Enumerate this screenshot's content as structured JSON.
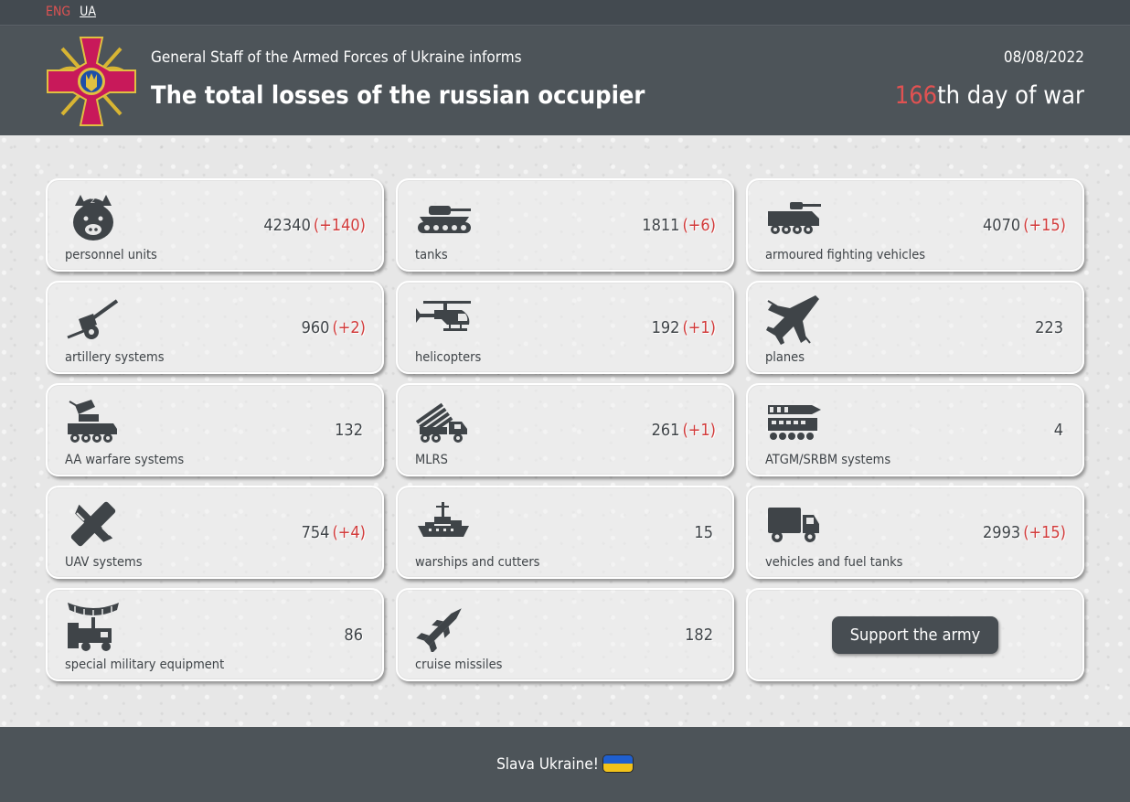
{
  "lang": {
    "eng": "ENG",
    "ua": "UA"
  },
  "header": {
    "subtitle": "General Staff of the Armed Forces of Ukraine informs",
    "title": "The total losses of the russian occupier",
    "date": "08/08/2022",
    "day_number": "166",
    "day_suffix": "th day of war"
  },
  "colors": {
    "accent_red": "#d23c3c",
    "dark": "#4d5459",
    "icon": "#3f4448"
  },
  "cards": [
    {
      "icon": "pig-icon",
      "label": "personnel units",
      "value": "42340",
      "delta": "(+140)"
    },
    {
      "icon": "tank-icon",
      "label": "tanks",
      "value": "1811",
      "delta": "(+6)"
    },
    {
      "icon": "afv-icon",
      "label": "armoured fighting vehicles",
      "value": "4070",
      "delta": "(+15)"
    },
    {
      "icon": "artillery-icon",
      "label": "artillery systems",
      "value": "960",
      "delta": "(+2)"
    },
    {
      "icon": "helicopter-icon",
      "label": "helicopters",
      "value": "192",
      "delta": "(+1)"
    },
    {
      "icon": "plane-icon",
      "label": "planes",
      "value": "223",
      "delta": ""
    },
    {
      "icon": "aa-warfare-icon",
      "label": "AA warfare systems",
      "value": "132",
      "delta": ""
    },
    {
      "icon": "mlrs-icon",
      "label": "MLRS",
      "value": "261",
      "delta": "(+1)"
    },
    {
      "icon": "atgm-icon",
      "label": "ATGM/SRBM systems",
      "value": "4",
      "delta": ""
    },
    {
      "icon": "uav-icon",
      "label": "UAV systems",
      "value": "754",
      "delta": "(+4)"
    },
    {
      "icon": "warship-icon",
      "label": "warships and cutters",
      "value": "15",
      "delta": ""
    },
    {
      "icon": "truck-icon",
      "label": "vehicles and fuel tanks",
      "value": "2993",
      "delta": "(+15)"
    },
    {
      "icon": "special-equipment-icon",
      "label": "special military equipment",
      "value": "86",
      "delta": ""
    },
    {
      "icon": "missile-icon",
      "label": "cruise missiles",
      "value": "182",
      "delta": ""
    }
  ],
  "support": {
    "label": "Support the army"
  },
  "footer": {
    "text": "Slava Ukraine!"
  }
}
